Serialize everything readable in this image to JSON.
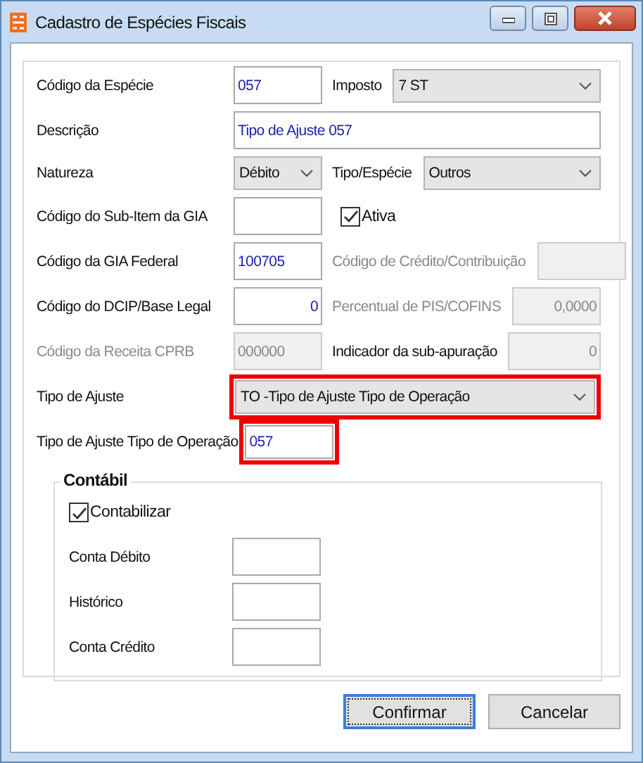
{
  "window": {
    "title": "Cadastro de Espécies Fiscais"
  },
  "rows": [
    {
      "label": {
        "text": "Código da Espécie",
        "disabled": false
      },
      "control": {
        "kind": "input",
        "value": "057",
        "disabled": false,
        "highlighted": false
      },
      "right": {
        "label": {
          "text": "Imposto",
          "disabled": false
        },
        "control": {
          "kind": "select",
          "value": "7 ST",
          "disabled": false,
          "highlighted": false
        }
      }
    },
    {
      "label": {
        "text": "Descrição",
        "disabled": false
      },
      "control": {
        "kind": "longinput",
        "value": "Tipo de Ajuste 057",
        "disabled": false,
        "highlighted": false
      }
    },
    {
      "label": {
        "text": "Natureza",
        "disabled": false
      },
      "control": {
        "kind": "select",
        "value": "Débito",
        "disabled": false,
        "highlighted": false
      },
      "right": {
        "label": {
          "text": "Tipo/Espécie",
          "disabled": false
        },
        "control": {
          "kind": "select",
          "value": "Outros",
          "disabled": false,
          "highlighted": false
        }
      }
    },
    {
      "label": {
        "text": "Código do Sub-Item da GIA",
        "disabled": false
      },
      "control": {
        "kind": "input",
        "disabled": false,
        "highlighted": false
      },
      "right": {
        "control": {
          "kind": "checkbox",
          "text": "Ativa",
          "checked": true
        }
      }
    },
    {
      "label": {
        "text": "Código da GIA Federal",
        "disabled": false
      },
      "control": {
        "kind": "input",
        "value": "100705",
        "disabled": false,
        "highlighted": false
      },
      "right": {
        "label": {
          "text": "Código de Crédito/Contribuição",
          "disabled": true
        },
        "control": {
          "kind": "number",
          "disabled": true,
          "highlighted": false
        }
      }
    },
    {
      "label": {
        "text": "Código do DCIP/Base Legal",
        "disabled": false
      },
      "control": {
        "kind": "number",
        "value": "0",
        "disabled": false,
        "highlighted": false
      },
      "right": {
        "label": {
          "text": "Percentual de PIS/COFINS",
          "disabled": true
        },
        "control": {
          "kind": "number",
          "value": "0,0000",
          "disabled": true,
          "highlighted": false
        }
      }
    },
    {
      "label": {
        "text": "Código da Receita CPRB",
        "disabled": true
      },
      "control": {
        "kind": "input",
        "value": "000000",
        "disabled": true,
        "highlighted": false
      },
      "right": {
        "label": {
          "text": "Indicador da sub-apuração",
          "disabled": false
        },
        "control": {
          "kind": "number",
          "value": "0",
          "disabled": true,
          "highlighted": false
        }
      }
    },
    {
      "label": {
        "text": "Tipo de Ajuste",
        "disabled": false
      },
      "control": {
        "kind": "longselect",
        "value": "TO -Tipo de Ajuste Tipo de Operação",
        "disabled": false,
        "highlighted": true
      }
    },
    {
      "label": {
        "text": "Tipo de Ajuste Tipo de Operação",
        "disabled": false
      },
      "control": {
        "kind": "input",
        "value": "057",
        "disabled": false,
        "highlighted": true
      }
    }
  ],
  "group": {
    "title": "Contábil",
    "checkbox": {
      "text": "Contabilizar",
      "checked": true
    },
    "fields": [
      {
        "label": "Conta Débito"
      },
      {
        "label": "Histórico"
      },
      {
        "label": "Conta Crédito"
      }
    ]
  },
  "buttons": [
    {
      "label": "Confirmar",
      "focused": true
    },
    {
      "label": "Cancelar",
      "focused": false
    }
  ]
}
